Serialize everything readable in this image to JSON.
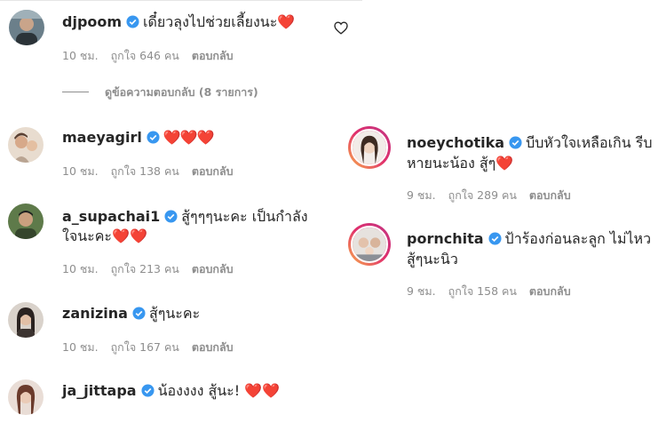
{
  "comments": [
    {
      "username": "djpoom",
      "text": "เดี๋ยวลุงไปช่วยเลี้ยงนะ❤️",
      "time": "10 ชม.",
      "likes": "ถูกใจ 646 คน",
      "reply": "ตอบกลับ"
    },
    {
      "username": "maeyagirl",
      "text": "❤️❤️❤️",
      "time": "10 ชม.",
      "likes": "ถูกใจ 138 คน",
      "reply": "ตอบกลับ"
    },
    {
      "username": "a_supachai1",
      "text": "สู้ๆๆๆนะคะ เป็นกำลัง",
      "text_cont": "ใจนะคะ❤️❤️",
      "time": "10 ชม.",
      "likes": "ถูกใจ 213 คน",
      "reply": "ตอบกลับ"
    },
    {
      "username": "zanizina",
      "text": "สู้ๆนะคะ",
      "time": "10 ชม.",
      "likes": "ถูกใจ 167 คน",
      "reply": "ตอบกลับ"
    },
    {
      "username": "ja_jittapa",
      "text": "น้องงงง สู้นะ! ❤️❤️"
    }
  ],
  "view_replies": "ดูข้อความตอบกลับ (8 รายการ)",
  "replies": [
    {
      "username": "noeychotika",
      "text": "บีบหัวใจเหลือเกิน รีบ",
      "text_cont": "หายนะน้อง สู้ๆ❤️",
      "time": "9 ชม.",
      "likes": "ถูกใจ 289 คน",
      "reply": "ตอบกลับ"
    },
    {
      "username": "pornchita",
      "text": "ป้าร้องก่อนละลูก ไม่ไหว",
      "text_cont": "สู้ๆนะนิว",
      "time": "9 ชม.",
      "likes": "ถูกใจ 158 คน",
      "reply": "ตอบกลับ"
    }
  ],
  "colors": {
    "verified": "#3897f0",
    "meta": "#8e8e8e",
    "heart_red": "#ed1c2a"
  }
}
